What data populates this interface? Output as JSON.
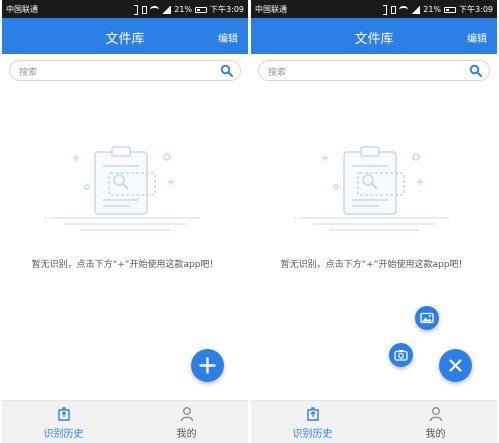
{
  "status_bar": {
    "carrier": "中国联通",
    "battery": "21%",
    "time": "下午3:09"
  },
  "header": {
    "title": "文件库",
    "edit_label": "编辑"
  },
  "search": {
    "placeholder": "搜索"
  },
  "empty_state": {
    "message": "暂无识别，点击下方“+”开始使用这款app吧！"
  },
  "tabs": [
    {
      "label": "识别历史",
      "icon": "document-upload-icon",
      "active": true
    },
    {
      "label": "我的",
      "icon": "person-icon",
      "active": false
    }
  ],
  "fab_menu": {
    "expanded_actions": [
      "image-icon",
      "camera-icon"
    ],
    "main_icon_collapsed": "plus-icon",
    "main_icon_expanded": "close-icon"
  },
  "colors": {
    "primary": "#2b7fe6",
    "status_bar": "#1a1a1a",
    "tab_bar": "#f2f2f2",
    "illustration": "#c9d8ee"
  }
}
